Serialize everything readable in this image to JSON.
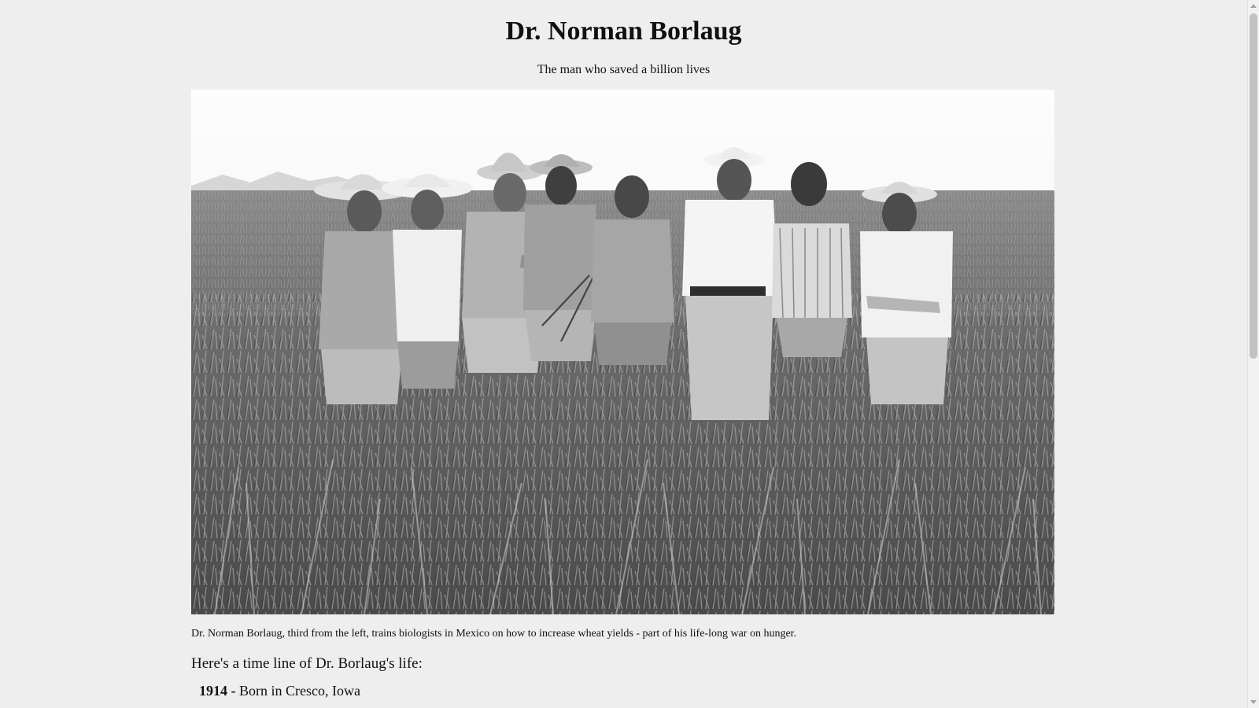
{
  "page": {
    "title": "Dr. Norman Borlaug",
    "subtitle": "The man who saved a billion lives"
  },
  "figure": {
    "photo_description": "Black-and-white photograph of eight men in work shirts and hats standing in a wheat field",
    "caption": "Dr. Norman Borlaug, third from the left, trains biologists in Mexico on how to increase wheat yields - part of his life-long war on hunger."
  },
  "timeline": {
    "intro": "Here's a time line of Dr. Borlaug's life:",
    "items": [
      {
        "year": "1914 -",
        "event": "Born in Cresco, Iowa"
      }
    ]
  }
}
